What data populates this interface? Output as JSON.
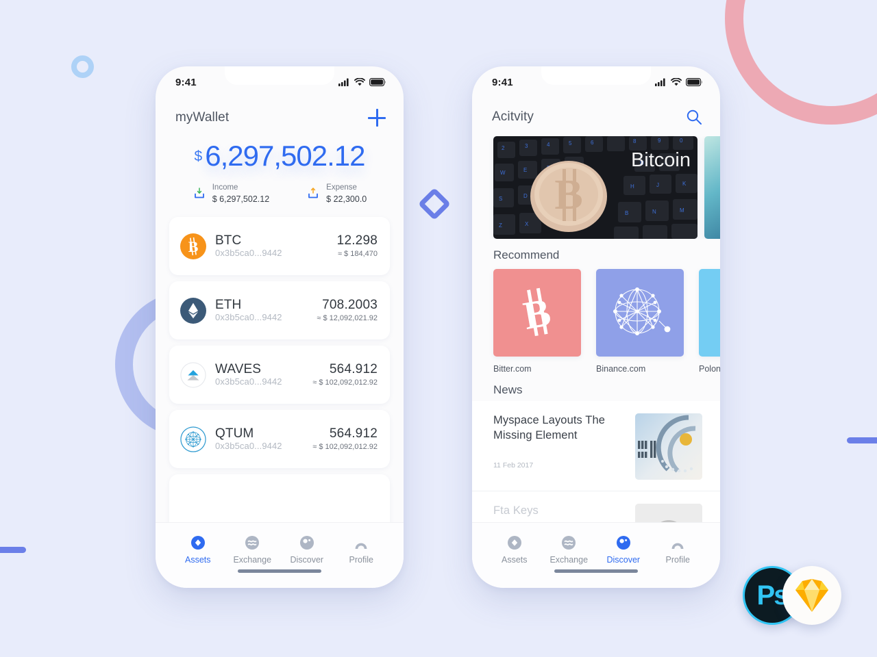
{
  "background": {
    "page_color": "#e8ecfb",
    "accent_blue": "#2f6bf0",
    "ring_pink": "#eda9b4",
    "ring_periwinkle": "#b3bff0",
    "ring_small_blue": "#aed2f7",
    "bar_blue": "#6b7fe8",
    "diamond_blue": "#6b7fe8"
  },
  "phone1": {
    "status": {
      "time": "9:41",
      "signal_icon": "signal-bars-icon",
      "wifi_icon": "wifi-icon",
      "battery_icon": "battery-icon"
    },
    "header": {
      "title": "myWallet",
      "add_icon": "plus-icon"
    },
    "balance": {
      "currency": "$",
      "amount": "6,297,502.12"
    },
    "flows": [
      {
        "label": "Income",
        "value": "$ 6,297,502.12",
        "icon": "download-tray-icon",
        "arrow_color": "#3bb55a"
      },
      {
        "label": "Expense",
        "value": "$ 22,300.0",
        "icon": "upload-tray-icon",
        "arrow_color": "#f5a623"
      }
    ],
    "assets": [
      {
        "symbol": "BTC",
        "address": "0x3b5ca0...9442",
        "amount": "12.298",
        "usd": "≈ $ 184,470",
        "icon": "bitcoin-coin-icon",
        "color": "#f7931a"
      },
      {
        "symbol": "ETH",
        "address": "0x3b5ca0...9442",
        "amount": "708.2003",
        "usd": "≈ $ 12,092,021.92",
        "icon": "ethereum-coin-icon",
        "color": "#3c5a78"
      },
      {
        "symbol": "WAVES",
        "address": "0x3b5ca0...9442",
        "amount": "564.912",
        "usd": "≈ $ 102,092,012.92",
        "icon": "waves-coin-icon",
        "color": "#23a2dd"
      },
      {
        "symbol": "QTUM",
        "address": "0x3b5ca0...9442",
        "amount": "564.912",
        "usd": "≈ $ 102,092,012.92",
        "icon": "qtum-coin-icon",
        "color": "#2e9ad0"
      }
    ],
    "tabs": [
      {
        "label": "Assets",
        "icon": "assets-diamond-icon",
        "active": true
      },
      {
        "label": "Exchange",
        "icon": "exchange-waves-icon",
        "active": false
      },
      {
        "label": "Discover",
        "icon": "discover-compass-icon",
        "active": false
      },
      {
        "label": "Profile",
        "icon": "profile-person-icon",
        "active": false
      }
    ]
  },
  "phone2": {
    "status": {
      "time": "9:41",
      "signal_icon": "signal-bars-icon",
      "wifi_icon": "wifi-icon",
      "battery_icon": "battery-icon"
    },
    "header": {
      "title": "Acitvity",
      "search_icon": "search-icon"
    },
    "banner": {
      "caption": "Bitcoin",
      "image": "bitcoin-coin-on-keyboard-photo"
    },
    "recommend": {
      "title": "Recommend",
      "items": [
        {
          "name": "Bitter.com",
          "icon": "bitcoin-b-icon",
          "color": "#f09090"
        },
        {
          "name": "Binance.com",
          "icon": "network-graph-icon",
          "color": "#8fa0e8"
        },
        {
          "name": "Polonie",
          "icon": "star-icon",
          "color": "#74cdf3"
        }
      ]
    },
    "news": {
      "title": "News",
      "items": [
        {
          "title": "Myspace Layouts The Missing Element",
          "date": "11 Feb 2017",
          "thumb": "ibm-hardware-photo",
          "faded": false
        },
        {
          "title": "Fta Keys",
          "date": "",
          "thumb": "portrait-photo",
          "faded": true
        }
      ]
    },
    "tabs": [
      {
        "label": "Assets",
        "icon": "assets-diamond-icon",
        "active": false
      },
      {
        "label": "Exchange",
        "icon": "exchange-waves-icon",
        "active": false
      },
      {
        "label": "Discover",
        "icon": "discover-compass-icon",
        "active": true
      },
      {
        "label": "Profile",
        "icon": "profile-person-icon",
        "active": false
      }
    ]
  },
  "badges": [
    {
      "name": "photoshop-badge",
      "label": "Ps"
    },
    {
      "name": "sketch-badge",
      "label": ""
    }
  ]
}
